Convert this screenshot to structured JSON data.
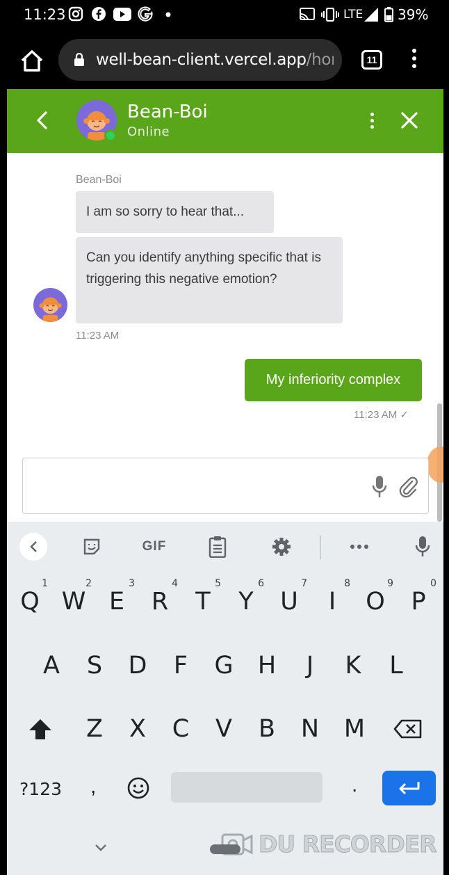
{
  "status_bar": {
    "time": "11:23",
    "network": "LTE",
    "battery": "39%"
  },
  "browser": {
    "url_host": "well-bean-client.vercel.app",
    "url_path": "/hom",
    "tab_count": "11"
  },
  "chat": {
    "bot_name": "Bean-Boi",
    "bot_status": "Online",
    "messages": [
      {
        "sender": "Bean-Boi",
        "text": "I am so sorry to hear that..."
      },
      {
        "text": "Can you identify anything specific that is triggering this negative emotion?"
      },
      {
        "time": "11:23 AM"
      },
      {
        "text": "My inferiority complex",
        "time": "11:23 AM ✓"
      }
    ],
    "input_value": ""
  },
  "keyboard": {
    "toolbar": {
      "gif": "GIF"
    },
    "row1": [
      {
        "k": "Q",
        "h": "1"
      },
      {
        "k": "W",
        "h": "2"
      },
      {
        "k": "E",
        "h": "3"
      },
      {
        "k": "R",
        "h": "4"
      },
      {
        "k": "T",
        "h": "5"
      },
      {
        "k": "Y",
        "h": "6"
      },
      {
        "k": "U",
        "h": "7"
      },
      {
        "k": "I",
        "h": "8"
      },
      {
        "k": "O",
        "h": "9"
      },
      {
        "k": "P",
        "h": "0"
      }
    ],
    "row2": [
      "A",
      "S",
      "D",
      "F",
      "G",
      "H",
      "J",
      "K",
      "L"
    ],
    "row3": [
      "Z",
      "X",
      "C",
      "V",
      "B",
      "N",
      "M"
    ],
    "symbols": "?123",
    "comma": ",",
    "period": "."
  },
  "watermark": "DU RECORDER",
  "colors": {
    "brand_green": "#5aa61a",
    "online_dot": "#2fd15a",
    "enter_key": "#1a73e8",
    "bubble_in": "#e6e6e8"
  }
}
